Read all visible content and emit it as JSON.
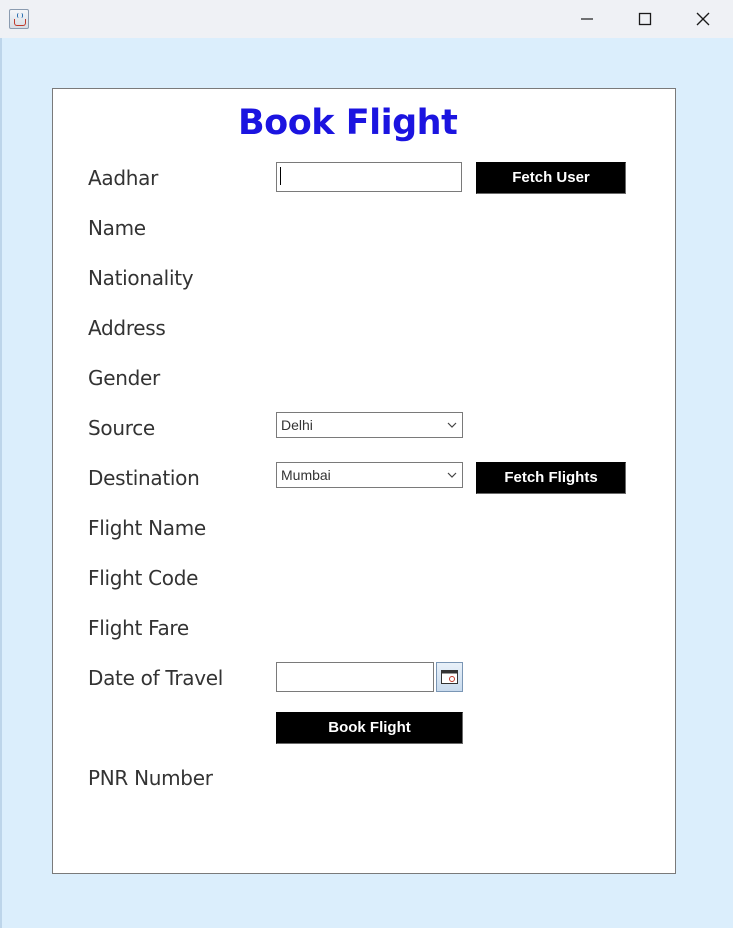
{
  "window": {
    "icon": "java-cup-icon",
    "controls": [
      "minimize-icon",
      "maximize-icon",
      "close-icon"
    ]
  },
  "form": {
    "title": "Book Flight",
    "labels": {
      "aadhar": "Aadhar",
      "name": "Name",
      "nationality": "Nationality",
      "address": "Address",
      "gender": "Gender",
      "source": "Source",
      "destination": "Destination",
      "flight_name": "Flight Name",
      "flight_code": "Flight Code",
      "flight_fare": "Flight Fare",
      "date_of_travel": "Date of Travel",
      "pnr_number": "PNR Number"
    },
    "aadhar_value": "",
    "source_selected": "Delhi",
    "destination_selected": "Mumbai",
    "date_value": "",
    "buttons": {
      "fetch_user": "Fetch User",
      "fetch_flights": "Fetch Flights",
      "book_flight": "Book Flight"
    },
    "calendar_icon": "calendar-icon"
  },
  "colors": {
    "title": "#1b14e0",
    "button_bg": "#000000",
    "button_text": "#ffffff",
    "window_bg": "#dbeefc",
    "panel_bg": "#ffffff"
  }
}
